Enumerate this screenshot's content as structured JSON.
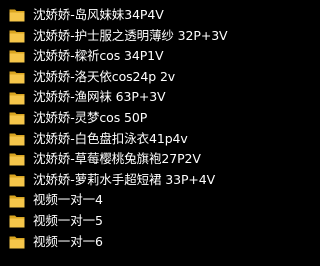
{
  "items": [
    {
      "name": "沈娇娇-岛风妹妹34P4V",
      "icon": "folder-icon"
    },
    {
      "name": "沈娇娇-护士服之透明薄纱 32P+3V",
      "icon": "folder-icon"
    },
    {
      "name": "沈娇娇-樑祈cos 34P1V",
      "icon": "folder-icon"
    },
    {
      "name": "沈娇娇-洛天依cos24p 2v",
      "icon": "folder-icon"
    },
    {
      "name": "沈娇娇-渔网袜 63P+3V",
      "icon": "folder-icon"
    },
    {
      "name": "沈娇娇-灵梦cos 50P",
      "icon": "folder-icon"
    },
    {
      "name": "沈娇娇-白色盘扣泳衣41p4v",
      "icon": "folder-icon"
    },
    {
      "name": "沈娇娇-草莓樱桃兔旗袍27P2V",
      "icon": "folder-icon"
    },
    {
      "name": "沈娇娇-萝莉水手超短裙 33P+4V",
      "icon": "folder-icon"
    },
    {
      "name": "视频一对一4",
      "icon": "folder-icon"
    },
    {
      "name": "视频一对一5",
      "icon": "folder-icon"
    },
    {
      "name": "视频一对一6",
      "icon": "folder-icon"
    }
  ],
  "colors": {
    "background": "#000000",
    "text": "#ffffff",
    "folder_back": "#d9a521",
    "folder_front": "#f5c64a"
  }
}
